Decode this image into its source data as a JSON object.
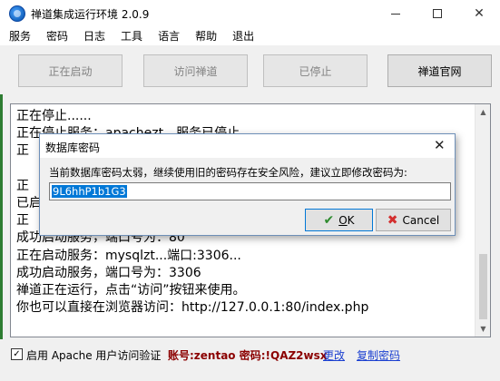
{
  "window": {
    "title": "禅道集成运行环境 2.0.9"
  },
  "menu": [
    "服务",
    "密码",
    "日志",
    "工具",
    "语言",
    "帮助",
    "退出"
  ],
  "buttons": {
    "starting": "正在启动",
    "visit": "访问禅道",
    "stopped": "已停止",
    "official_site": "禅道官网"
  },
  "log": {
    "lines": [
      "正在停止......",
      "正在停止服务：apachezt，服务已停止",
      "正",
      "",
      "正",
      "已启",
      "正",
      "成功启动服务，端口号为：80",
      "正在启动服务：mysqlzt...端口:3306...",
      "成功启动服务，端口号为：3306",
      "禅道正在运行，点击“访问”按钮来使用。",
      "你也可以直接在浏览器访问：http://127.0.0.1:80/index.php"
    ]
  },
  "footer": {
    "checkbox_checked": true,
    "apache_auth_label": "启用 Apache 用户访问验证",
    "credentials": "账号:zentao 密码:!QAZ2wsx",
    "change_link": "更改",
    "copy_link": "复制密码"
  },
  "dialog": {
    "title": "数据库密码",
    "message": "当前数据库密码太弱，继续使用旧的密码存在安全风险，建议立即修改密码为:",
    "password_value": "9L6hhP1b1G3",
    "ok_label": "OK",
    "ok_accel": "O",
    "cancel_label": "Cancel"
  },
  "colors": {
    "credentials": "#8b0000",
    "link": "#1a3fd0",
    "selection": "#0078d7",
    "ok_icon": "#2e8b2e",
    "cancel_icon": "#d32f2f"
  },
  "icons": {
    "app": "zentao-app-icon",
    "ok": "checkmark-icon",
    "cancel": "x-icon",
    "close": "close-icon"
  }
}
